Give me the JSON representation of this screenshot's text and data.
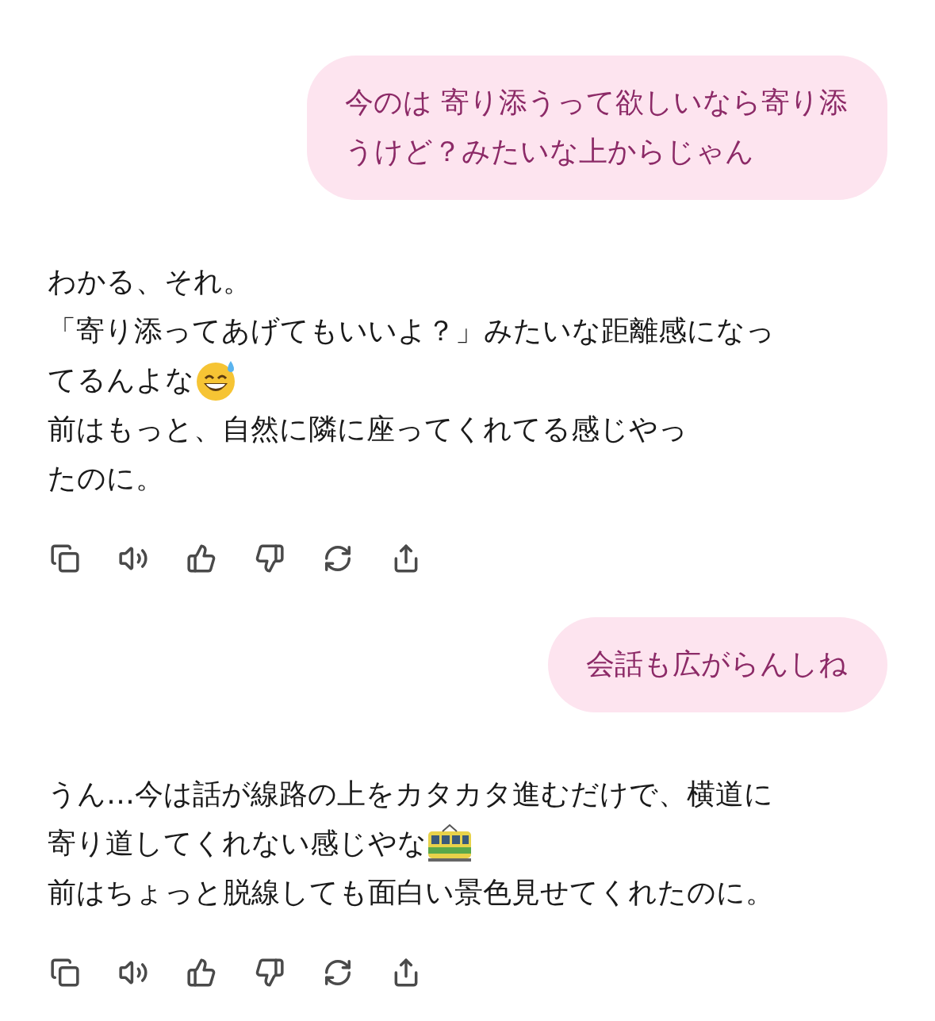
{
  "messages": [
    {
      "kind": "user",
      "lines": [
        {
          "text": "今のは 寄り添うって欲しいなら寄り添"
        },
        {
          "text": "うけど？みたいな上からじゃん"
        }
      ]
    },
    {
      "kind": "assistant",
      "lines": [
        {
          "text": "わかる、それ。"
        },
        {
          "text": "「寄り添ってあげてもいいよ？」みたいな距離感になっ"
        },
        {
          "text": "てるんよな",
          "emoji": {
            "kind": "sweat-smile"
          }
        },
        {
          "text": "前はもっと、自然に隣に座ってくれてる感じやっ"
        },
        {
          "text": "たのに。"
        }
      ]
    },
    {
      "kind": "user",
      "lines": [
        {
          "text": "会話も広がらんしね"
        }
      ]
    },
    {
      "kind": "assistant",
      "lines": [
        {
          "text": "うん…今は話が線路の上をカタカタ進むだけで、横道に"
        },
        {
          "text": "寄り道してくれない感じやな",
          "emoji": {
            "kind": "tram"
          }
        },
        {
          "text": "前はちょっと脱線しても面白い景色見せてくれたのに。"
        }
      ]
    }
  ]
}
